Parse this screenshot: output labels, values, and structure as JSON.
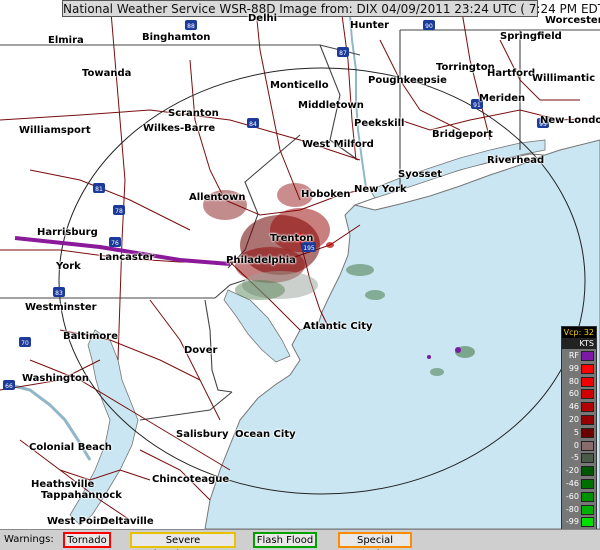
{
  "title": "National Weather Service WSR-88D Image from: DIX 04/09/2011 23:24 UTC ( 7:24 PM EDT)",
  "colors": {
    "water": "#c9e6f2",
    "land": "#ffffff",
    "state_border": "#444444",
    "highway": "#7a0c0c",
    "coast": "#777777",
    "radar_range": "#222222",
    "storm_line": "#8a1a9a"
  },
  "cities": [
    "Elmira",
    "Binghamton",
    "Delhi",
    "Hunter",
    "Worcester",
    "Springfield",
    "Towanda",
    "Monticello",
    "Poughkeepsie",
    "Torrington",
    "Hartford",
    "Willimantic",
    "Middletown",
    "Meriden",
    "Scranton",
    "Peekskill",
    "New London",
    "Williamsport",
    "Wilkes-Barre",
    "Bridgeport",
    "West Milford",
    "Riverhead",
    "Allentown",
    "Hoboken",
    "New York",
    "Syosset",
    "Harrisburg",
    "Trenton",
    "York",
    "Lancaster",
    "Philadelphia",
    "Westminster",
    "Atlantic City",
    "Baltimore",
    "Dover",
    "Washington",
    "Salisbury",
    "Ocean City",
    "Colonial Beach",
    "Chincoteague",
    "Heathsville",
    "Tappahannock",
    "West Point",
    "Deltaville"
  ],
  "highway_shields": [
    "81",
    "88",
    "87",
    "90",
    "84",
    "91",
    "95",
    "80",
    "76",
    "78",
    "295",
    "70",
    "66",
    "83",
    "195"
  ],
  "legend": {
    "header": "Vcp: 32",
    "unit": "KTS",
    "items": [
      {
        "label": "RF",
        "color": "#7b1aa6"
      },
      {
        "label": "99",
        "color": "#ff0000"
      },
      {
        "label": "80",
        "color": "#ee0000"
      },
      {
        "label": "60",
        "color": "#d10000"
      },
      {
        "label": "46",
        "color": "#b30000"
      },
      {
        "label": "20",
        "color": "#950000"
      },
      {
        "label": "5",
        "color": "#6a0000"
      },
      {
        "label": "0",
        "color": "#8a6b6b"
      },
      {
        "label": "-5",
        "color": "#4a5b4a"
      },
      {
        "label": "-20",
        "color": "#005500"
      },
      {
        "label": "-46",
        "color": "#007000"
      },
      {
        "label": "-60",
        "color": "#009000"
      },
      {
        "label": "-80",
        "color": "#00b000"
      },
      {
        "label": "-99",
        "color": "#00e000"
      },
      {
        "label": "ND",
        "color": "#777777"
      }
    ]
  },
  "warnings": {
    "label": "Warnings:",
    "items": [
      {
        "label": "Tornado",
        "color": "#ff0000"
      },
      {
        "label": "Severe Thunderstorm",
        "color": "#e8c200"
      },
      {
        "label": "Flash Flood",
        "color": "#00a000"
      },
      {
        "label": "Special Marine",
        "color": "#ff8c00"
      }
    ]
  }
}
